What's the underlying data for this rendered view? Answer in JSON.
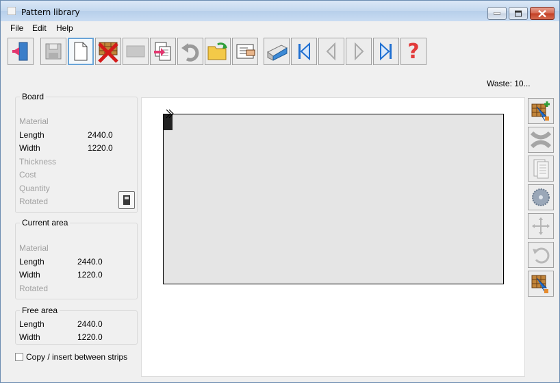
{
  "window": {
    "title": "Pattern library"
  },
  "menu": {
    "items": [
      "File",
      "Edit",
      "Help"
    ]
  },
  "toolbar": {
    "buttons": [
      {
        "icon": "exit-icon"
      },
      {
        "icon": "save-disk-icon"
      },
      {
        "icon": "new-page-icon",
        "active": true
      },
      {
        "icon": "delete-pattern-icon"
      },
      {
        "icon": "blank-disabled-icon"
      },
      {
        "icon": "copy-pattern-icon"
      },
      {
        "icon": "undo-icon"
      },
      {
        "icon": "open-folder-icon"
      },
      {
        "icon": "properties-icon"
      },
      {
        "icon": "print-icon"
      },
      {
        "icon": "first-icon"
      },
      {
        "icon": "previous-icon"
      },
      {
        "icon": "next-icon"
      },
      {
        "icon": "last-icon"
      },
      {
        "icon": "help-icon"
      }
    ]
  },
  "waste": "Waste: 10...",
  "board": {
    "label": "Board",
    "rows": [
      {
        "key": "Material",
        "value": "",
        "disabled": true
      },
      {
        "key": "Length",
        "value": "2440.0",
        "disabled": false
      },
      {
        "key": "Width",
        "value": "1220.0",
        "disabled": false
      },
      {
        "key": "Thickness",
        "value": "",
        "disabled": true
      },
      {
        "key": "Cost",
        "value": "",
        "disabled": true
      },
      {
        "key": "Quantity",
        "value": "",
        "disabled": true
      },
      {
        "key": "Rotated",
        "value": "",
        "disabled": true
      }
    ]
  },
  "current_area": {
    "label": "Current area",
    "rows": [
      {
        "key": "Material",
        "value": "",
        "disabled": true
      },
      {
        "key": "Length",
        "value": "2440.0",
        "disabled": false
      },
      {
        "key": "Width",
        "value": "1220.0",
        "disabled": false
      },
      {
        "key": "Rotated",
        "value": "",
        "disabled": true
      }
    ]
  },
  "free_area": {
    "label": "Free area",
    "rows": [
      {
        "key": "Length",
        "value": "2440.0"
      },
      {
        "key": "Width",
        "value": "1220.0"
      }
    ]
  },
  "copy_insert": {
    "label": "Copy / insert between strips",
    "checked": false
  },
  "right_tools": [
    {
      "icon": "add-pattern-icon"
    },
    {
      "icon": "remove-x-icon"
    },
    {
      "icon": "pages-icon"
    },
    {
      "icon": "saw-blade-icon"
    },
    {
      "icon": "move-arrows-icon"
    },
    {
      "icon": "rotate-icon"
    },
    {
      "icon": "select-pattern-icon"
    }
  ],
  "colors": {
    "title_gradient": "#c4d8ef",
    "close_button": "#c33e24",
    "board_fill": "#e5e5e5",
    "disabled_text": "#a0a0a0",
    "nav_blue": "#1f6fd1",
    "help_red": "#e23b3b"
  }
}
